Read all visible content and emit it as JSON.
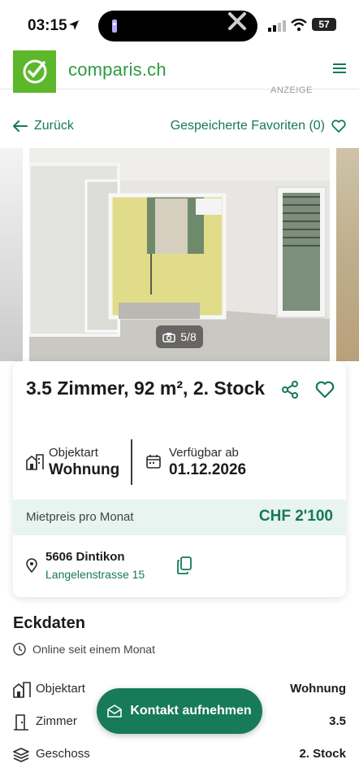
{
  "status_bar": {
    "time": "03:15",
    "battery": "57"
  },
  "header": {
    "logo_text": "comparis.ch",
    "ad_label": "ANZEIGE"
  },
  "nav": {
    "back_label": "Zurück",
    "favorites_label": "Gespeicherte Favoriten (0)"
  },
  "gallery": {
    "counter": "5/8"
  },
  "listing": {
    "title": "3.5 Zimmer, 92 m², 2. Stock",
    "object_type_label": "Objektart",
    "object_type_value": "Wohnung",
    "available_label": "Verfügbar ab",
    "available_value": "01.12.2026",
    "price_label": "Mietpreis pro Monat",
    "price_value": "CHF 2'100",
    "city": "5606 Dintikon",
    "street": "Langelenstrasse 15"
  },
  "eckdaten": {
    "title": "Eckdaten",
    "online_since": "Online seit einem Monat",
    "rows": [
      {
        "label": "Objektart",
        "value": "Wohnung",
        "icon": "building-icon"
      },
      {
        "label": "Zimmer",
        "value": "3.5",
        "icon": "door-icon"
      },
      {
        "label": "Geschoss",
        "value": "2. Stock",
        "icon": "layers-icon"
      }
    ]
  },
  "contact_button": "Kontakt aufnehmen",
  "colors": {
    "brand_green": "#5cb82a",
    "accent": "#157a55",
    "price_bg": "#e7f4ef"
  }
}
